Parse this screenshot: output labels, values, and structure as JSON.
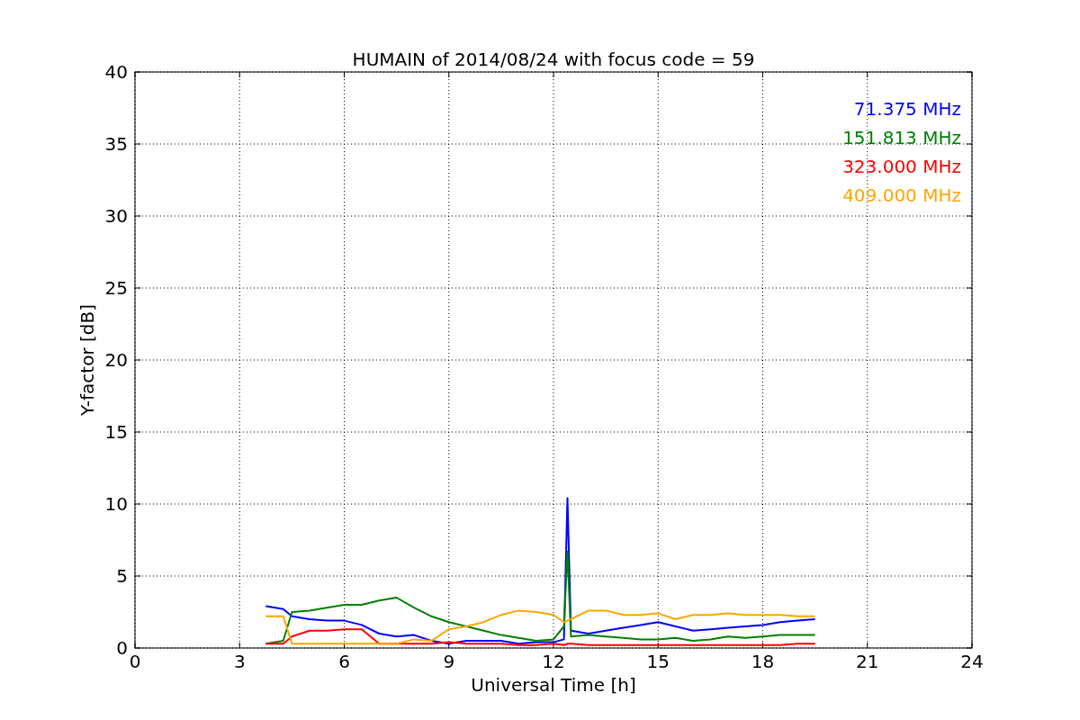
{
  "plot": {
    "chart_data": {
      "type": "line",
      "title": "HUMAIN of 2014/08/24 with focus code = 59",
      "xlabel": "Universal Time [h]",
      "ylabel": "Y-factor [dB]",
      "x": [
        3.75,
        4.25,
        4.5,
        5,
        5.5,
        6,
        6.5,
        7,
        7.5,
        8,
        8.5,
        9,
        9.5,
        10,
        10.5,
        11,
        11.5,
        12,
        12.3,
        12.4,
        12.5,
        13,
        13.5,
        14,
        14.5,
        15,
        15.5,
        16,
        16.5,
        17,
        17.5,
        18,
        18.5,
        19,
        19.5
      ],
      "series": [
        {
          "name": "71.375 MHz",
          "color": "#0000ff",
          "values": [
            2.9,
            2.7,
            2.2,
            2.0,
            1.9,
            1.9,
            1.6,
            1.0,
            0.8,
            0.9,
            0.5,
            0.3,
            0.5,
            0.5,
            0.5,
            0.3,
            0.4,
            0.4,
            0.6,
            10.4,
            1.2,
            1.0,
            1.2,
            1.4,
            1.6,
            1.8,
            1.5,
            1.2,
            1.3,
            1.4,
            1.5,
            1.6,
            1.8,
            1.9,
            2.0
          ]
        },
        {
          "name": "151.813 MHz",
          "color": "#008000",
          "values": [
            0.3,
            0.5,
            2.5,
            2.6,
            2.8,
            3.0,
            3.0,
            3.3,
            3.5,
            2.8,
            2.2,
            1.8,
            1.5,
            1.2,
            0.9,
            0.7,
            0.5,
            0.6,
            1.5,
            6.7,
            0.8,
            0.9,
            0.8,
            0.7,
            0.6,
            0.6,
            0.7,
            0.5,
            0.6,
            0.8,
            0.7,
            0.8,
            0.9,
            0.9,
            0.9
          ]
        },
        {
          "name": "323.000 MHz",
          "color": "#ff0000",
          "values": [
            0.3,
            0.3,
            0.8,
            1.2,
            1.2,
            1.3,
            1.3,
            0.3,
            0.3,
            0.3,
            0.3,
            0.4,
            0.3,
            0.3,
            0.3,
            0.2,
            0.2,
            0.3,
            0.2,
            0.3,
            0.3,
            0.2,
            0.2,
            0.2,
            0.2,
            0.2,
            0.2,
            0.2,
            0.2,
            0.2,
            0.2,
            0.2,
            0.2,
            0.3,
            0.3
          ]
        },
        {
          "name": "409.000 MHz",
          "color": "#ffa500",
          "values": [
            2.2,
            2.2,
            0.3,
            0.3,
            0.3,
            0.3,
            0.3,
            0.3,
            0.3,
            0.6,
            0.5,
            1.3,
            1.5,
            1.8,
            2.3,
            2.6,
            2.5,
            2.3,
            1.8,
            1.9,
            2.0,
            2.6,
            2.6,
            2.3,
            2.3,
            2.4,
            2.0,
            2.3,
            2.3,
            2.4,
            2.3,
            2.3,
            2.3,
            2.2,
            2.2
          ]
        }
      ],
      "grid": true,
      "xlim": [
        0,
        24
      ],
      "ylim": [
        0,
        40
      ],
      "xticks": [
        0,
        3,
        6,
        9,
        12,
        15,
        18,
        21,
        24
      ],
      "yticks": [
        0,
        5,
        10,
        15,
        20,
        25,
        30,
        35,
        40
      ]
    }
  }
}
